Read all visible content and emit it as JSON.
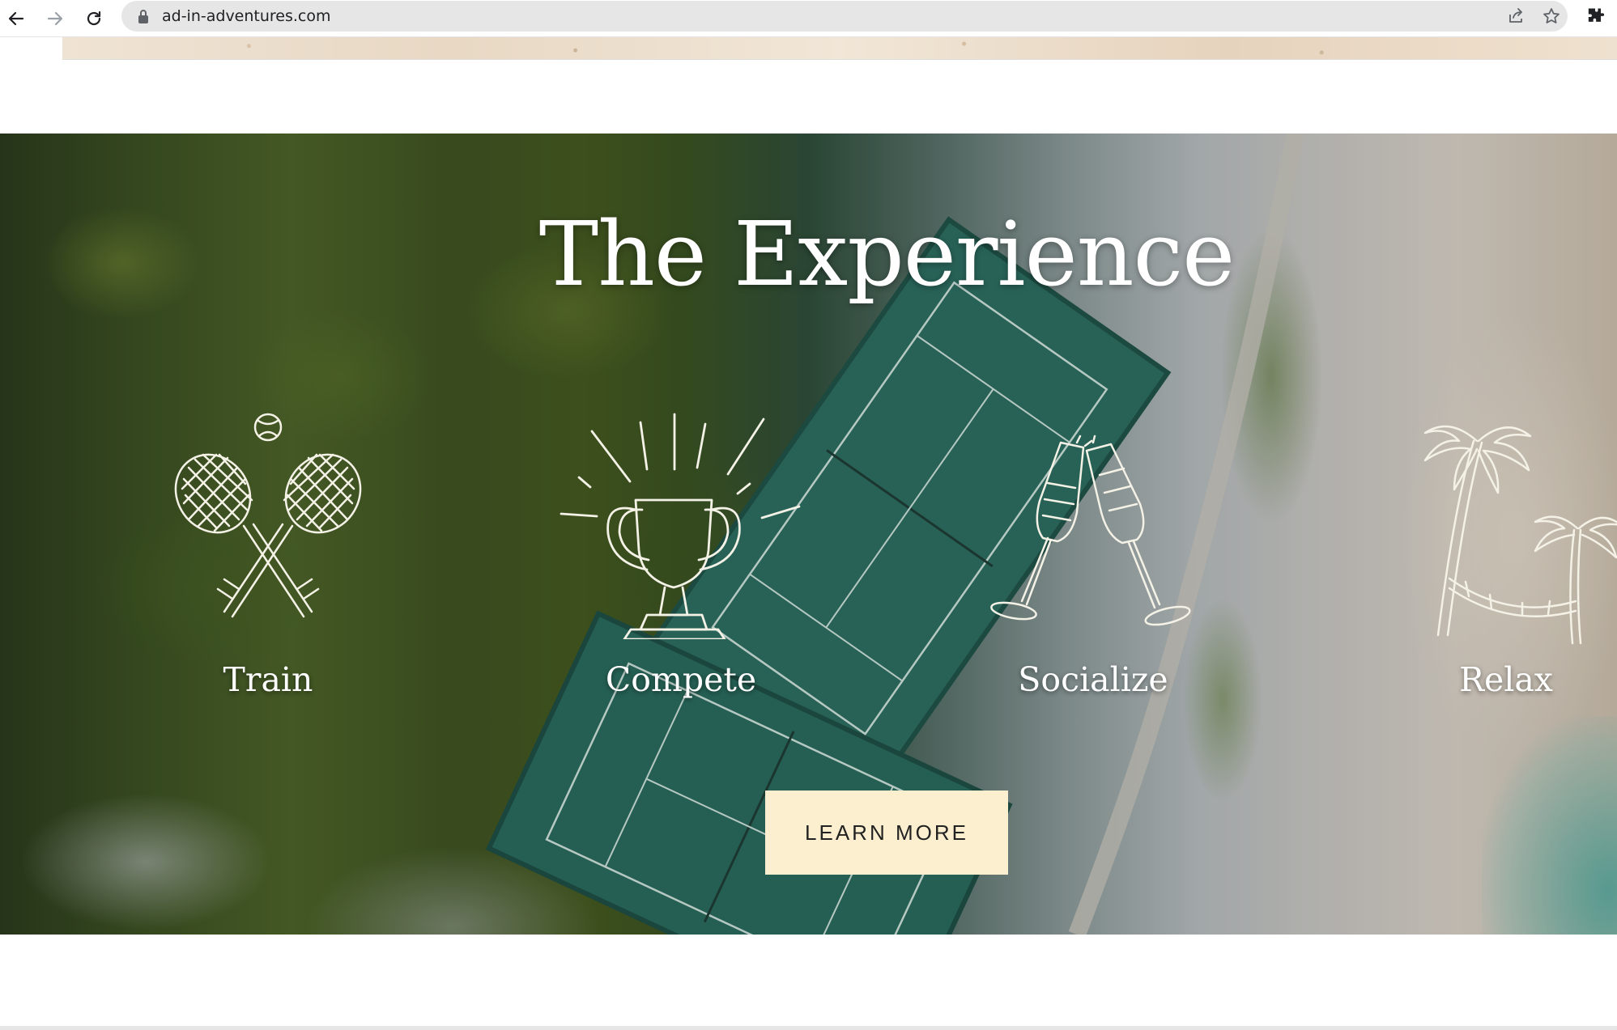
{
  "browser": {
    "url": "ad-in-adventures.com",
    "icons": {
      "back": "arrow-left-icon",
      "forward": "arrow-right-icon",
      "reload": "reload-icon",
      "lock": "lock-icon",
      "share": "share-icon",
      "bookmark": "star-icon",
      "extensions": "puzzle-icon"
    }
  },
  "hero": {
    "title": "The Experience",
    "features": [
      {
        "label": "Train",
        "icon": "tennis-rackets-icon"
      },
      {
        "label": "Compete",
        "icon": "trophy-icon"
      },
      {
        "label": "Socialize",
        "icon": "champagne-glasses-icon"
      },
      {
        "label": "Relax",
        "icon": "palm-trees-hammock-icon"
      }
    ],
    "cta_label": "LEARN MORE"
  },
  "colors": {
    "cta_background": "#fbefcf",
    "hero_text": "#ffffff",
    "omnibox": "#e6e6e6"
  }
}
